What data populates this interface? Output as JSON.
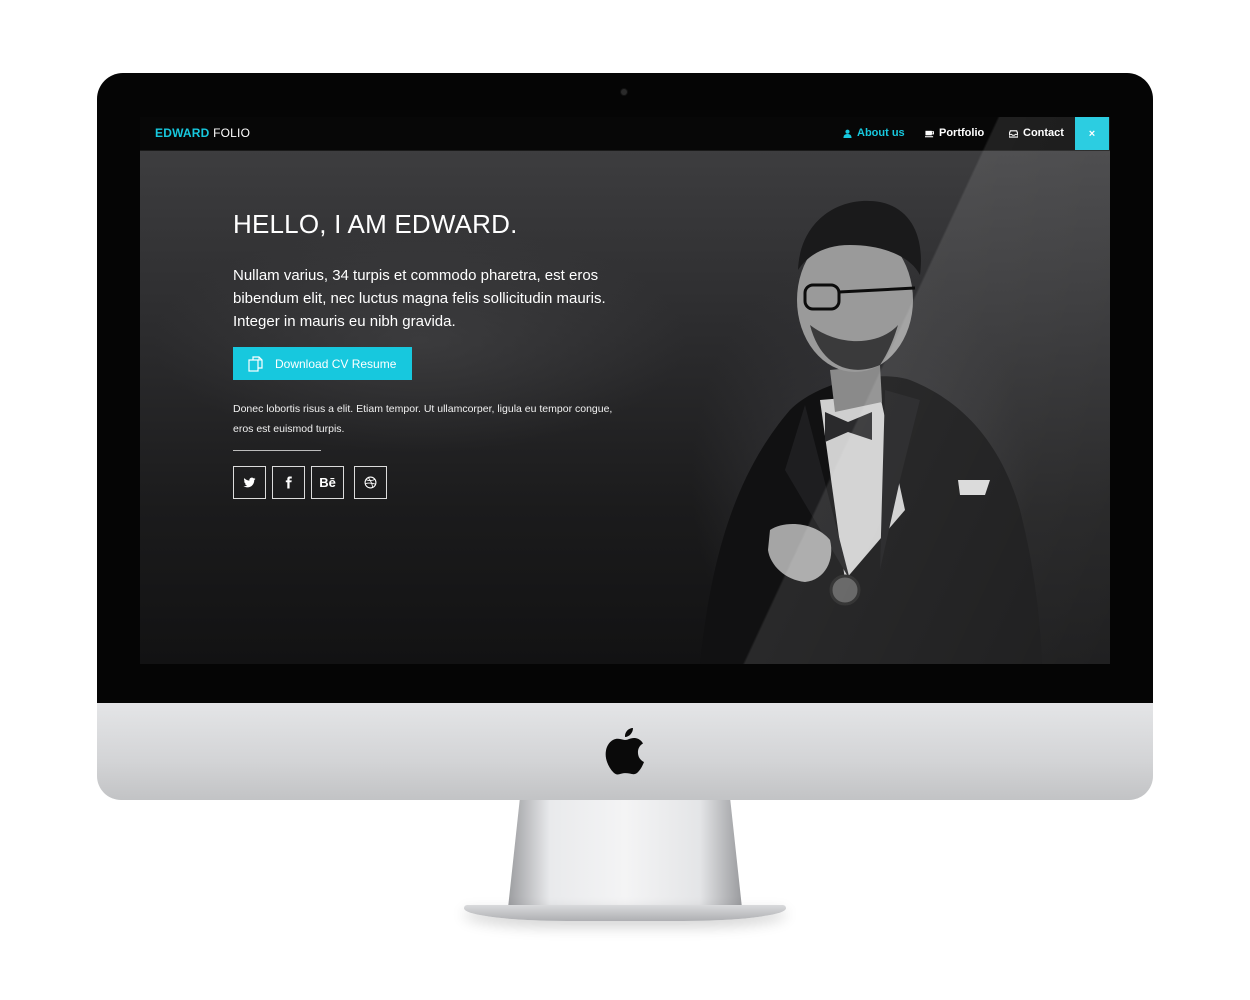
{
  "brand": {
    "first": "EDWARD",
    "last": "FOLIO"
  },
  "nav": {
    "items": [
      {
        "label": "About us",
        "icon": "user-icon",
        "active": true
      },
      {
        "label": "Portfolio",
        "icon": "coffee-icon",
        "active": false
      },
      {
        "label": "Contact",
        "icon": "inbox-icon",
        "active": false
      }
    ],
    "close_label": "×"
  },
  "hero": {
    "title": "HELLO, I AM EDWARD.",
    "lead": "Nullam varius, 34 turpis et commodo pharetra, est eros bibendum elit, nec luctus magna felis sollicitudin mauris. Integer in mauris eu nibh gravida.",
    "cta_label": "Download CV Resume",
    "cta_icon": "copy-icon",
    "small_text": "Donec lobortis risus a elit. Etiam tempor. Ut ullamcorper, ligula eu tempor congue, eros est euismod turpis."
  },
  "social": [
    {
      "name": "twitter",
      "icon": "twitter-icon",
      "label": ""
    },
    {
      "name": "facebook",
      "icon": "facebook-icon",
      "label": ""
    },
    {
      "name": "behance",
      "icon": "behance-icon",
      "label": "Bē"
    },
    {
      "name": "dribbble",
      "icon": "dribbble-icon",
      "label": ""
    }
  ],
  "colors": {
    "accent": "#17c8de",
    "navbar": "#070707",
    "text": "#ffffff"
  }
}
